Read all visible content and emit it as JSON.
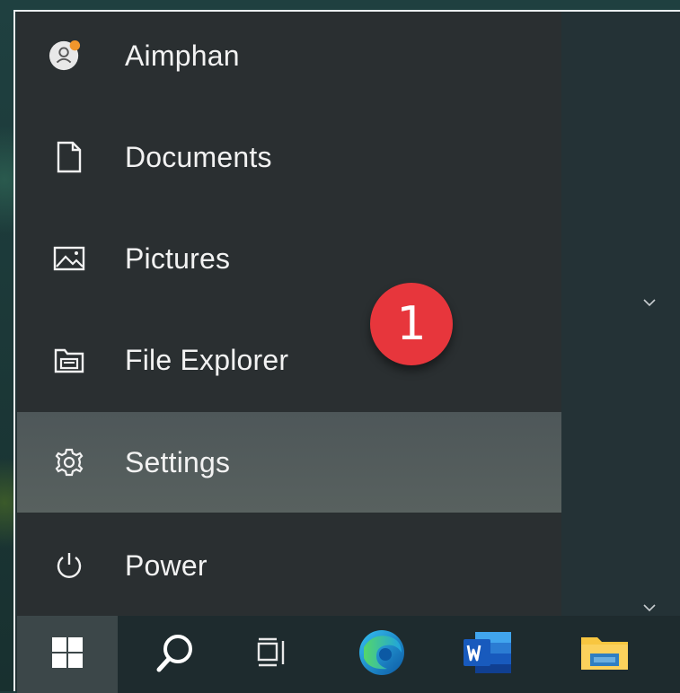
{
  "start_menu": {
    "items": [
      {
        "label": "Aimphan",
        "icon": "user-avatar-icon"
      },
      {
        "label": "Documents",
        "icon": "document-icon"
      },
      {
        "label": "Pictures",
        "icon": "pictures-icon"
      },
      {
        "label": "File Explorer",
        "icon": "file-explorer-icon"
      },
      {
        "label": "Settings",
        "icon": "gear-icon",
        "highlighted": true
      },
      {
        "label": "Power",
        "icon": "power-icon"
      }
    ]
  },
  "annotation": {
    "badge_text": "1",
    "badge_color": "#e7363c"
  },
  "taskbar": {
    "items": [
      "start-windows-icon",
      "search-icon",
      "task-view-icon",
      "edge-icon",
      "word-icon",
      "file-explorer-taskbar-icon"
    ]
  },
  "colors": {
    "menu_bg": "#2a2f31",
    "highlight": "#545d5d",
    "taskbar": "#1e2b2e",
    "accent_orange": "#f0962c"
  }
}
